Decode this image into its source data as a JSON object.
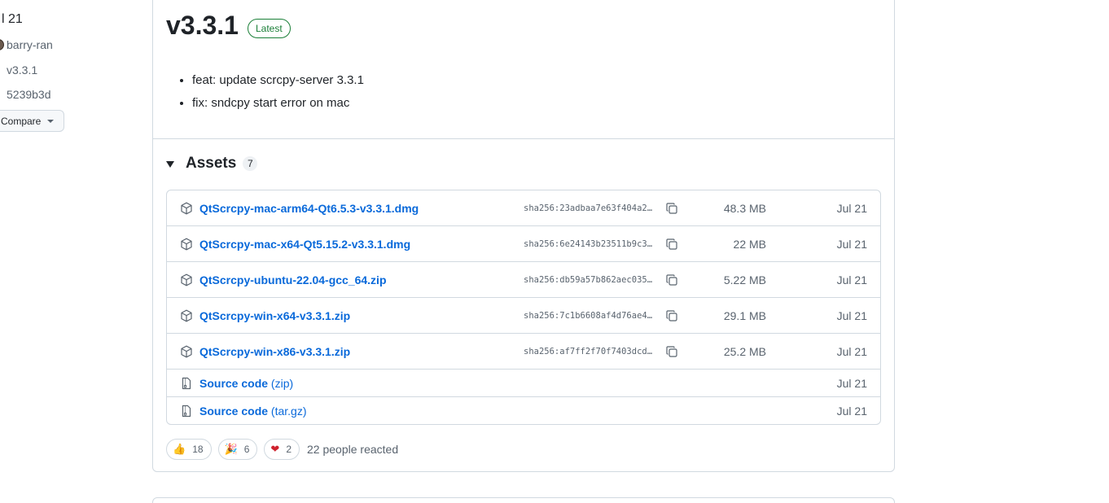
{
  "sidebar": {
    "date": "l 21",
    "author": "barry-ran",
    "tag": "v3.3.1",
    "commit": "5239b3d",
    "compare_label": "Compare"
  },
  "release": {
    "version": "v3.3.1",
    "badge": "Latest",
    "notes": [
      "feat: update scrcpy-server 3.3.1",
      "fix: sndcpy start error on mac"
    ]
  },
  "assets": {
    "title": "Assets",
    "count": "7",
    "items": [
      {
        "name": "QtScrcpy-mac-arm64-Qt6.5.3-v3.3.1.dmg",
        "sha": "sha256:23adbaa7e63f404a2…",
        "size": "48.3 MB",
        "date": "Jul 21"
      },
      {
        "name": "QtScrcpy-mac-x64-Qt5.15.2-v3.3.1.dmg",
        "sha": "sha256:6e24143b23511b9c3…",
        "size": "22 MB",
        "date": "Jul 21"
      },
      {
        "name": "QtScrcpy-ubuntu-22.04-gcc_64.zip",
        "sha": "sha256:db59a57b862aec035…",
        "size": "5.22 MB",
        "date": "Jul 21"
      },
      {
        "name": "QtScrcpy-win-x64-v3.3.1.zip",
        "sha": "sha256:7c1b6608af4d76ae4…",
        "size": "29.1 MB",
        "date": "Jul 21"
      },
      {
        "name": "QtScrcpy-win-x86-v3.3.1.zip",
        "sha": "sha256:af7ff2f70f7403dcd…",
        "size": "25.2 MB",
        "date": "Jul 21"
      }
    ],
    "source": [
      {
        "name": "Source code",
        "suffix": "(zip)",
        "date": "Jul 21"
      },
      {
        "name": "Source code",
        "suffix": "(tar.gz)",
        "date": "Jul 21"
      }
    ]
  },
  "reactions": {
    "thumbs_up": "18",
    "hooray": "6",
    "heart": "2",
    "summary": "22 people reacted"
  },
  "colors": {
    "link": "#0969da",
    "latest_green": "#1a7f37",
    "border": "#d1d9e0",
    "muted": "#59636e"
  }
}
